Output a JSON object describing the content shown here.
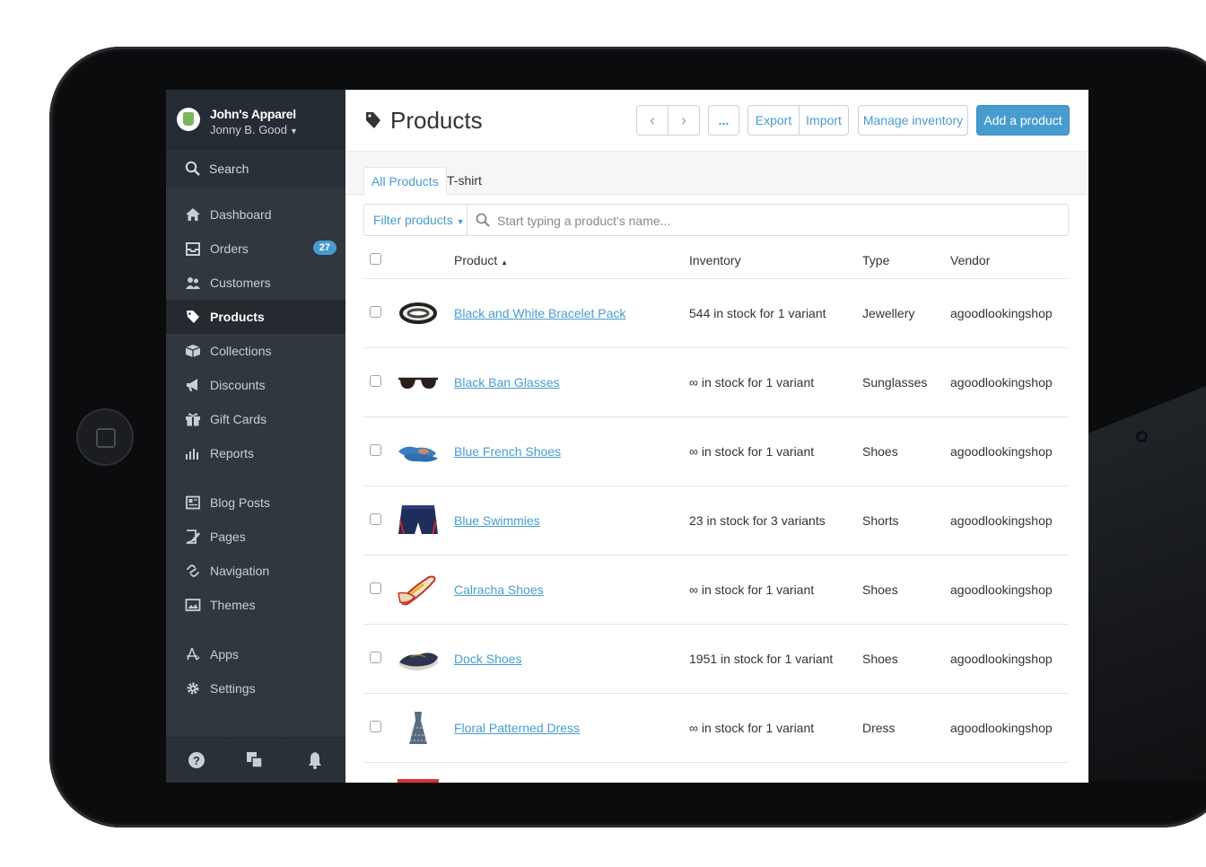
{
  "store": {
    "name": "John's Apparel",
    "user": "Jonny B. Good"
  },
  "sidebar": {
    "search_label": "Search",
    "items": [
      {
        "label": "Dashboard",
        "icon": "home-icon"
      },
      {
        "label": "Orders",
        "icon": "inbox-icon",
        "badge": "27"
      },
      {
        "label": "Customers",
        "icon": "customers-icon"
      },
      {
        "label": "Products",
        "icon": "tag-icon",
        "active": true
      },
      {
        "label": "Collections",
        "icon": "collections-icon"
      },
      {
        "label": "Discounts",
        "icon": "megaphone-icon"
      },
      {
        "label": "Gift Cards",
        "icon": "gift-icon"
      },
      {
        "label": "Reports",
        "icon": "bar-chart-icon"
      },
      {
        "label": "Blog Posts",
        "icon": "newspaper-icon"
      },
      {
        "label": "Pages",
        "icon": "page-edit-icon"
      },
      {
        "label": "Navigation",
        "icon": "link-icon"
      },
      {
        "label": "Themes",
        "icon": "image-icon"
      },
      {
        "label": "Apps",
        "icon": "apps-icon"
      },
      {
        "label": "Settings",
        "icon": "gear-icon"
      }
    ]
  },
  "header": {
    "title": "Products",
    "more_label": "...",
    "export_label": "Export",
    "import_label": "Import",
    "manage_label": "Manage inventory",
    "add_label": "Add a product"
  },
  "tabs": [
    "All Products",
    "T-shirt"
  ],
  "filter": {
    "label": "Filter products",
    "placeholder": "Start typing a product's name..."
  },
  "table": {
    "columns": [
      "Product",
      "Inventory",
      "Type",
      "Vendor"
    ],
    "rows": [
      {
        "name": "Black and White Bracelet Pack",
        "inventory": "544 in stock for 1 variant",
        "type": "Jewellery",
        "vendor": "agoodlookingshop",
        "thumb": "bracelet"
      },
      {
        "name": "Black Ban Glasses",
        "inventory": "∞ in stock for 1 variant",
        "type": "Sunglasses",
        "vendor": "agoodlookingshop",
        "thumb": "glasses"
      },
      {
        "name": "Blue French Shoes",
        "inventory": "∞ in stock for 1 variant",
        "type": "Shoes",
        "vendor": "agoodlookingshop",
        "thumb": "blue-shoes"
      },
      {
        "name": "Blue Swimmies",
        "inventory": "23 in stock for 3 variants",
        "type": "Shorts",
        "vendor": "agoodlookingshop",
        "thumb": "shorts"
      },
      {
        "name": "Calracha Shoes",
        "inventory": "∞ in stock for 1 variant",
        "type": "Shoes",
        "vendor": "agoodlookingshop",
        "thumb": "flats"
      },
      {
        "name": "Dock Shoes",
        "inventory": "1951 in stock for 1 variant",
        "type": "Shoes",
        "vendor": "agoodlookingshop",
        "thumb": "dock-shoes"
      },
      {
        "name": "Floral Patterned Dress",
        "inventory": "∞ in stock for 1 variant",
        "type": "Dress",
        "vendor": "agoodlookingshop",
        "thumb": "dress"
      }
    ]
  },
  "colors": {
    "accent": "#479ccf",
    "sidebar": "#30373f",
    "sidebar_dark": "#262c33"
  }
}
